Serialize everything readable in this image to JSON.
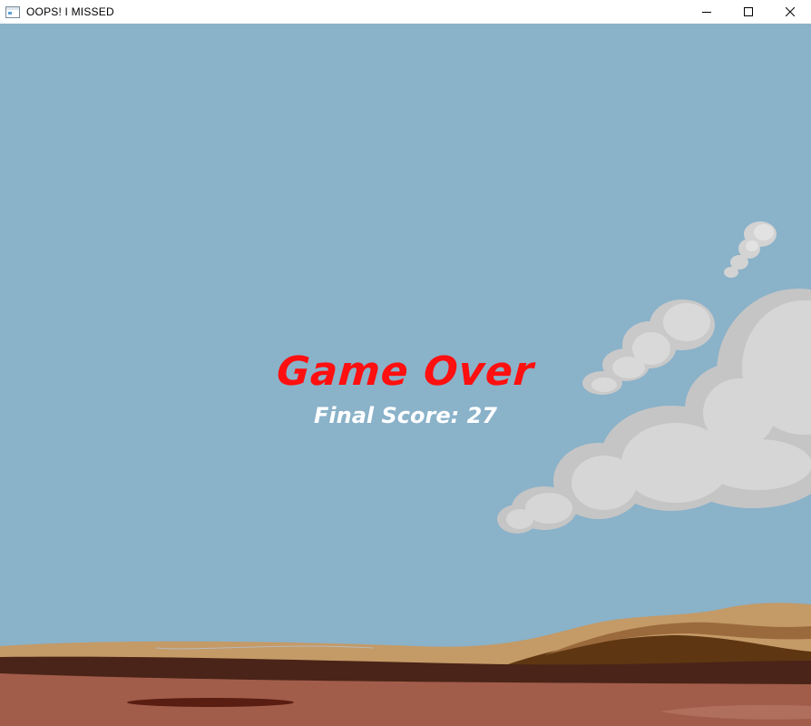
{
  "window": {
    "title": "OOPS! I MISSED",
    "controls": {
      "minimize_icon": "minimize-icon",
      "maximize_icon": "maximize-icon",
      "close_icon": "close-icon"
    }
  },
  "game": {
    "state": "game-over",
    "game_over_text": "Game Over",
    "final_score_text": "Final Score: 27",
    "final_score": 27,
    "colors": {
      "sky": "#8ab2c9",
      "game_over": "#ff0f0f",
      "score_text": "#ffffff",
      "cloud": "#d2d2d2"
    }
  }
}
